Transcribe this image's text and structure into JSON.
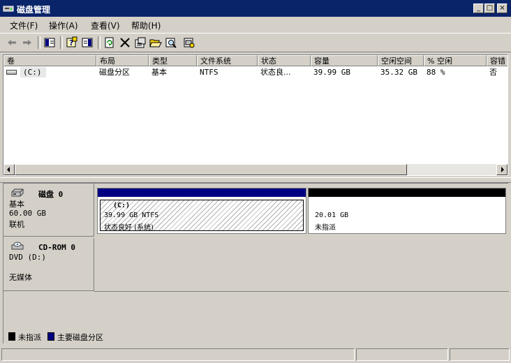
{
  "window": {
    "title": "磁盘管理",
    "icon": "disk-management-icon",
    "buttons": {
      "minimize": "_",
      "maximize": "□",
      "close": "×"
    },
    "title_color": "#0a246a"
  },
  "menu": [
    {
      "label": "文件(F)"
    },
    {
      "label": "操作(A)"
    },
    {
      "label": "查看(V)"
    },
    {
      "label": "帮助(H)"
    }
  ],
  "toolbar": {
    "buttons": [
      "back-icon",
      "forward-icon",
      "show-hide-console-tree-icon",
      "help-icon",
      "export-list-icon",
      "refresh-icon",
      "delete-icon",
      "properties-icon",
      "open-folder-icon",
      "find-icon",
      "rescan-icon"
    ]
  },
  "list": {
    "columns": [
      "卷",
      "布局",
      "类型",
      "文件系统",
      "状态",
      "容量",
      "空闲空间",
      "% 空闲",
      "容错"
    ],
    "rows": [
      {
        "volume": "(C:)",
        "layout": "磁盘分区",
        "type": "基本",
        "fs": "NTFS",
        "status": "状态良...",
        "capacity": "39.99 GB",
        "free": "35.32 GB",
        "pct_free": "88 %",
        "fault_tolerance": "否"
      }
    ]
  },
  "disks": [
    {
      "name": "磁盘 0",
      "type": "基本",
      "size": "60.00 GB",
      "state": "联机",
      "icon": "hard-disk-icon",
      "partitions": [
        {
          "label": "(C:)",
          "detail": "39.99 GB NTFS",
          "status": "状态良好 (系统)",
          "bar_color": "#000080",
          "share": 0.6665
        },
        {
          "detail": "20.01 GB",
          "status": "未指派",
          "bar_color": "#000000",
          "share": 0.3335
        }
      ]
    },
    {
      "name": "CD-ROM 0",
      "type": "DVD (D:)",
      "state": "无媒体",
      "icon": "cd-rom-icon"
    }
  ],
  "legend": [
    {
      "label": "未指派",
      "color": "#000000"
    },
    {
      "label": "主要磁盘分区",
      "color": "#000080"
    }
  ]
}
